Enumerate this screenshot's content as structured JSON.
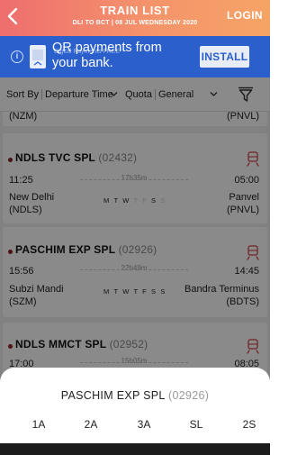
{
  "header": {
    "title": "TRAIN LIST",
    "subtitle": "DLI TO BCT | 08 JUL WEDNESDAY 2020",
    "login_label": "LOGIN"
  },
  "ad": {
    "text": "QR payments from your bank.",
    "faint_text": "Digital Payments   FREE",
    "install_label": "INSTALL"
  },
  "sort": {
    "sort_label": "Sort By",
    "sort_value": "Departure Time",
    "quota_label": "Quota",
    "quota_value": "General"
  },
  "top_card": {
    "left_code": "(NZM)",
    "right_code": "(PNVL)"
  },
  "trains": [
    {
      "name": "NDLS TVC SPL",
      "number": "(02432)",
      "dep_time": "11:25",
      "arr_time": "05:00",
      "duration": "17h35m",
      "from_name": "New Delhi",
      "from_code": "(NDLS)",
      "to_name": "Panvel",
      "to_code": "(PNVL)",
      "days": [
        {
          "d": "M",
          "on": true
        },
        {
          "d": "T",
          "on": true
        },
        {
          "d": "W",
          "on": true
        },
        {
          "d": "T",
          "on": false
        },
        {
          "d": "F",
          "on": false
        },
        {
          "d": "S",
          "on": true
        },
        {
          "d": "S",
          "on": false
        }
      ]
    },
    {
      "name": "PASCHIM EXP SPL",
      "number": "(02926)",
      "dep_time": "15:56",
      "arr_time": "14:45",
      "duration": "22h49m",
      "from_name": "Subzi Mandi",
      "from_code": "(SZM)",
      "to_name": "Bandra Terminus",
      "to_code": "(BDTS)",
      "days": [
        {
          "d": "M",
          "on": true
        },
        {
          "d": "T",
          "on": true
        },
        {
          "d": "W",
          "on": true
        },
        {
          "d": "T",
          "on": true
        },
        {
          "d": "F",
          "on": true
        },
        {
          "d": "S",
          "on": true
        },
        {
          "d": "S",
          "on": true
        }
      ]
    },
    {
      "name": "NDLS MMCT SPL",
      "number": "(02952)",
      "dep_time": "17:00",
      "arr_time": "08:05",
      "duration": "15h05m"
    }
  ],
  "sheet": {
    "train_name": "PASCHIM EXP SPL",
    "train_number": "(02926)",
    "classes": [
      "1A",
      "2A",
      "3A",
      "SL",
      "2S"
    ]
  },
  "colors": {
    "header_start": "#ee6e6e",
    "header_end": "#f6a466",
    "ad_background": "#2a5fcc",
    "train_dot": "#8b2222",
    "train_icon": "#d04444"
  },
  "icons": [
    "back-icon",
    "ad-info-icon",
    "ad-logo-icon",
    "sort-caret-icon",
    "quota-caret-icon",
    "filter-icon",
    "train-icon"
  ]
}
